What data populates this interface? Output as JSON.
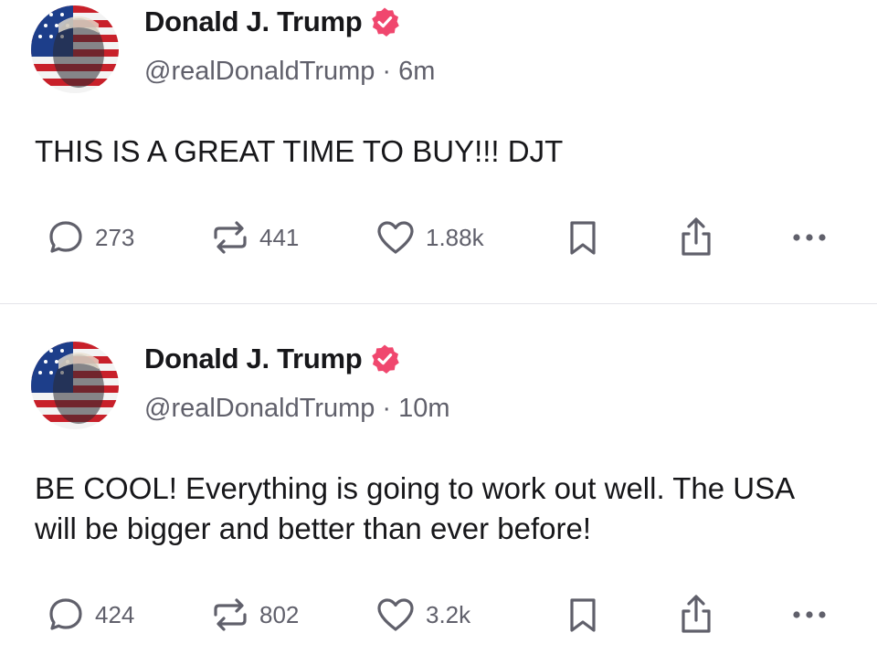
{
  "colors": {
    "text_primary": "#17171a",
    "text_secondary": "#60606b",
    "verified_badge": "#f0476e",
    "icon": "#60606b",
    "divider": "#e4e4e9"
  },
  "posts": [
    {
      "author": {
        "name": "Donald J. Trump",
        "handle": "@realDonaldTrump",
        "verified_icon": "verified-badge-icon"
      },
      "separator": "·",
      "time": "6m",
      "text": "THIS IS A GREAT TIME TO BUY!!! DJT",
      "stats": {
        "replies": "273",
        "reposts": "441",
        "likes": "1.88k"
      },
      "icons": [
        "reply-icon",
        "repost-icon",
        "like-icon",
        "bookmark-icon",
        "share-icon",
        "more-icon"
      ]
    },
    {
      "author": {
        "name": "Donald J. Trump",
        "handle": "@realDonaldTrump",
        "verified_icon": "verified-badge-icon"
      },
      "separator": "·",
      "time": "10m",
      "text": "BE COOL! Everything is going to work out well. The USA will be bigger and better than ever before!",
      "stats": {
        "replies": "424",
        "reposts": "802",
        "likes": "3.2k"
      },
      "icons": [
        "reply-icon",
        "repost-icon",
        "like-icon",
        "bookmark-icon",
        "share-icon",
        "more-icon"
      ]
    }
  ]
}
